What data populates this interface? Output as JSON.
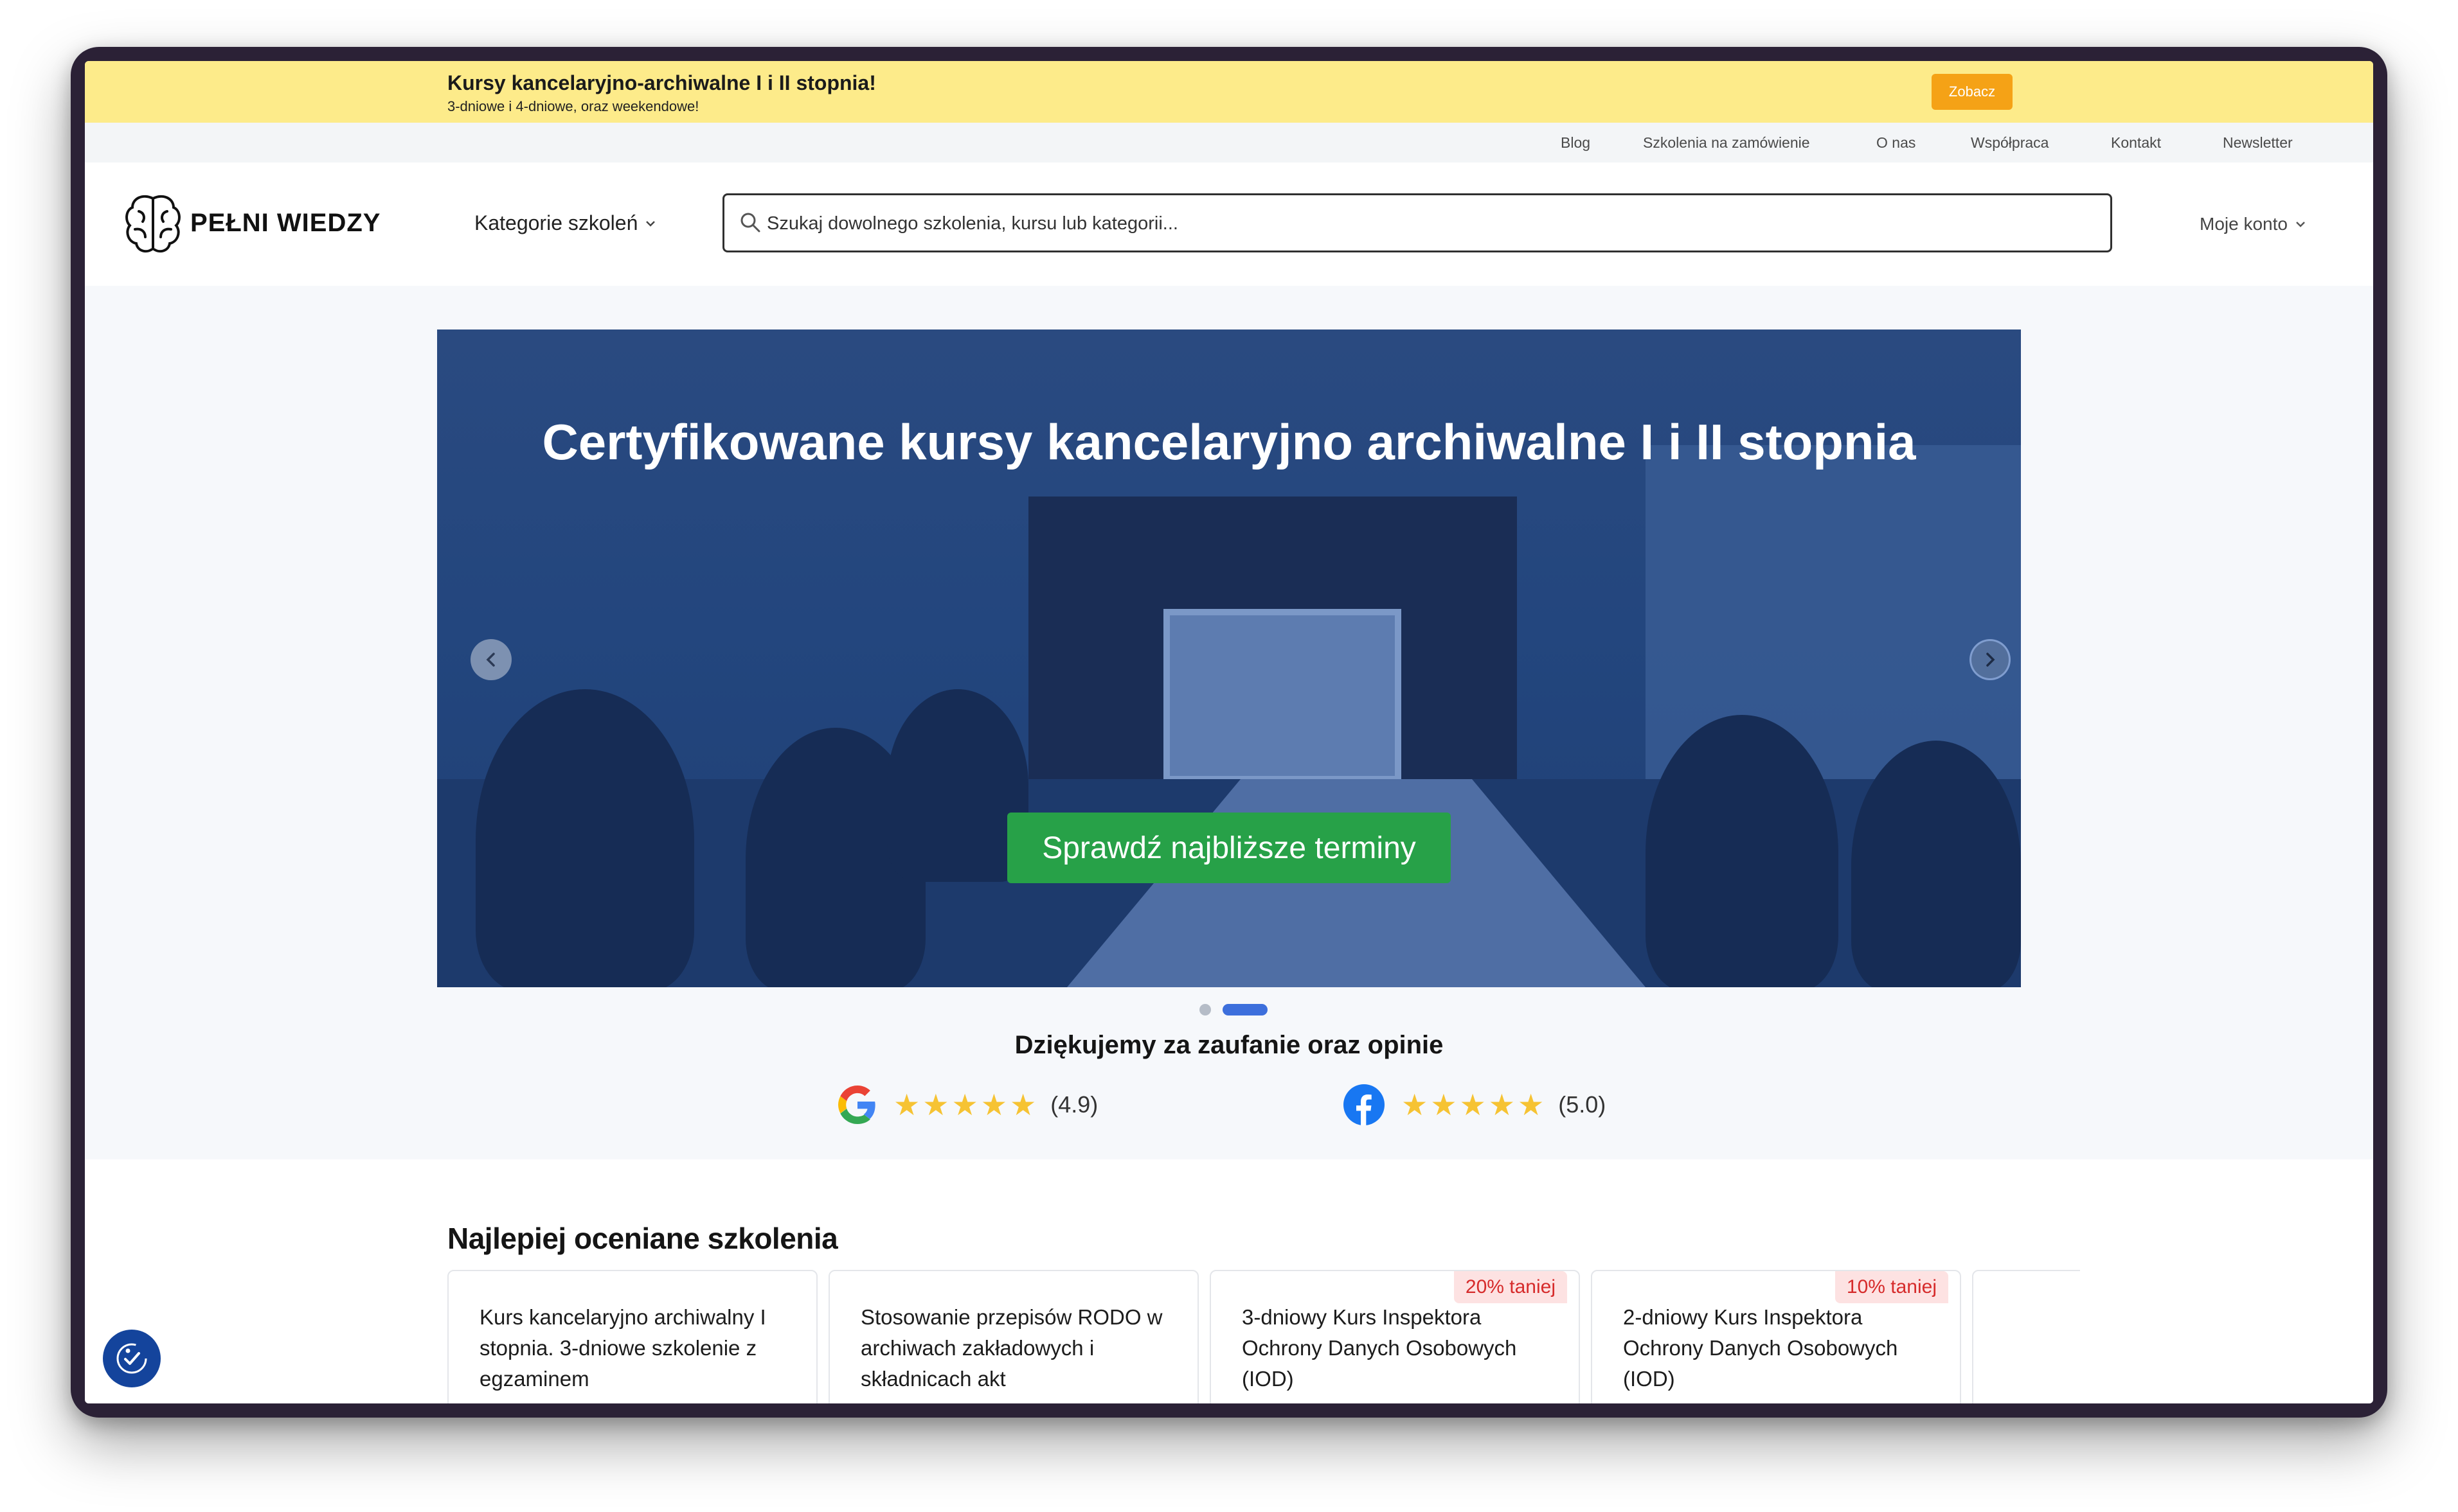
{
  "promo": {
    "title": "Kursy kancelaryjno-archiwalne I i II stopnia!",
    "subtitle": "3-dniowe i 4-dniowe, oraz weekendowe!",
    "button": "Zobacz"
  },
  "toplinks": [
    "Blog",
    "Szkolenia na zamówienie",
    "O nas",
    "Współpraca",
    "Kontakt",
    "Newsletter"
  ],
  "header": {
    "logo": "PEŁNI WIEDZY",
    "categories": "Kategorie szkoleń",
    "search_placeholder": "Szukaj dowolnego szkolenia, kursu lub kategorii...",
    "account": "Moje konto"
  },
  "hero": {
    "title": "Certyfikowane kursy kancelaryjno archiwalne I i II stopnia",
    "cta": "Sprawdź najbliższe terminy",
    "active_slide": 2,
    "slide_count": 2
  },
  "trust": {
    "heading": "Dziękujemy za zaufanie oraz opinie",
    "google": {
      "stars": "★★★★★",
      "score": "(4.9)",
      "rating": 4.9
    },
    "facebook": {
      "stars": "★★★★★",
      "score": "(5.0)",
      "rating": 5.0
    }
  },
  "best": {
    "title": "Najlepiej oceniane szkolenia",
    "cards": [
      {
        "title": "Kurs kancelaryjno archiwalny I stopnia. 3-dniowe szkolenie z egzaminem",
        "badge": ""
      },
      {
        "title": "Stosowanie przepisów RODO w archiwach zakładowych i składnicach akt",
        "badge": ""
      },
      {
        "title": "3-dniowy Kurs Inspektora Ochrony Danych Osobowych (IOD)",
        "badge": "20% taniej"
      },
      {
        "title": "2-dniowy Kurs Inspektora Ochrony Danych Osobowych (IOD)",
        "badge": "10% taniej"
      },
      {
        "title": "",
        "badge": ""
      }
    ]
  },
  "colors": {
    "promo_bg": "#fdeb8a",
    "promo_button": "#f5a216",
    "cta_green": "#27a148",
    "star": "#f6c333",
    "badge_red": "#d62b2b"
  }
}
